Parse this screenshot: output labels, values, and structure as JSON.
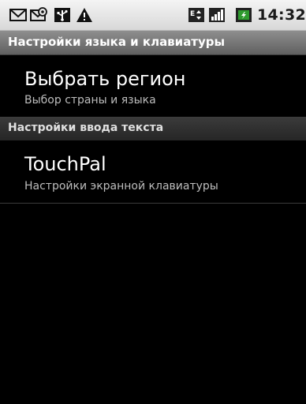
{
  "status_bar": {
    "time": "14:32",
    "icons": [
      "mail-icon",
      "email-notification-icon",
      "usb-icon",
      "warning-icon",
      "data-transfer-icon",
      "signal-strength-icon",
      "battery-icon"
    ]
  },
  "window": {
    "title": "Настройки языка и клавиатуры"
  },
  "items": [
    {
      "title": "Выбрать регион",
      "summary": "Выбор страны и языка"
    }
  ],
  "category": {
    "title": "Настройки ввода текста"
  },
  "items2": [
    {
      "title": "TouchPal",
      "summary": "Настройки экранной клавиатуры"
    }
  ],
  "colors": {
    "status_bar_bg": "#e6e6e6",
    "title_bar_bg": "#777777",
    "background": "#000000",
    "battery_green": "#2e9a2e"
  }
}
